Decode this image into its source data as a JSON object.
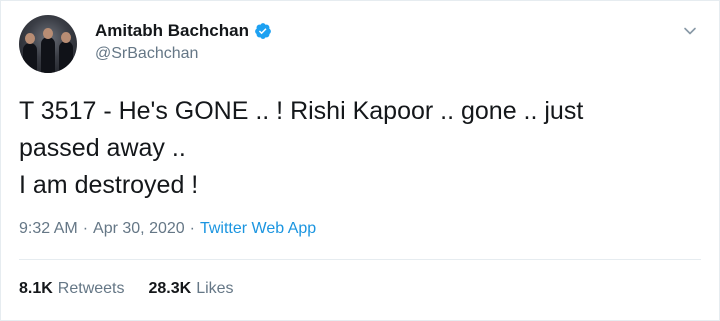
{
  "author": {
    "display_name": "Amitabh Bachchan",
    "handle": "@SrBachchan",
    "verified": true
  },
  "tweet": {
    "lines": [
      "T 3517 - He's GONE .. ! Rishi Kapoor .. gone .. just",
      "passed away ..",
      "I am destroyed !"
    ]
  },
  "meta": {
    "time": "9:32 AM",
    "separator1": "·",
    "date": "Apr 30, 2020",
    "separator2": "·",
    "source": "Twitter Web App"
  },
  "stats": {
    "retweets_count": "8.1K",
    "retweets_label": "Retweets",
    "likes_count": "28.3K",
    "likes_label": "Likes"
  },
  "colors": {
    "accent": "#1b95e0",
    "verified_badge": "#1da1f2",
    "secondary_text": "#657786",
    "primary_text": "#14171a",
    "divider": "#e6ecf0"
  },
  "icons": {
    "verified": "verified-badge-icon",
    "menu": "chevron-down-icon"
  }
}
